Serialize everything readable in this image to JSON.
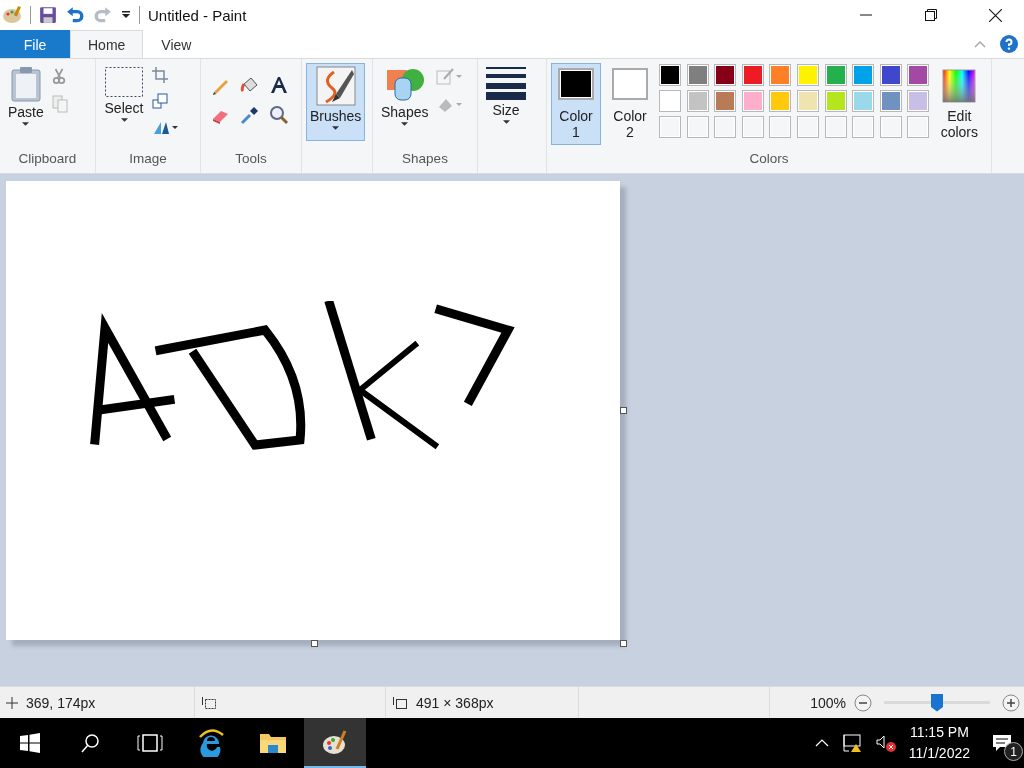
{
  "title_bar": {
    "title": "Untitled - Paint"
  },
  "tabs": [
    {
      "label": "File",
      "kind": "file",
      "selected": false
    },
    {
      "label": "Home",
      "kind": "tab",
      "selected": true
    },
    {
      "label": "View",
      "kind": "tab",
      "selected": false
    }
  ],
  "ribbon": {
    "groups": [
      {
        "kind": "clipboard",
        "label": "Clipboard",
        "button": {
          "label": "Paste",
          "selected": false
        }
      },
      {
        "kind": "image",
        "label": "Image",
        "button": {
          "label": "Select",
          "selected": false
        }
      },
      {
        "kind": "tools",
        "label": "Tools"
      },
      {
        "kind": "brushes",
        "button": {
          "label": "Brushes",
          "selected": true
        }
      },
      {
        "kind": "shapes",
        "label": "Shapes",
        "button": {
          "label": "Shapes",
          "selected": false
        }
      },
      {
        "kind": "size",
        "button": {
          "label": "Size",
          "selected": false
        }
      },
      {
        "kind": "colors",
        "label": "Colors",
        "current": [
          {
            "label": "Color 1",
            "color": "#000000",
            "selected": true
          },
          {
            "label": "Color 2",
            "color": "#ffffff",
            "selected": false
          }
        ],
        "palette": [
          {
            "color": "#000000"
          },
          {
            "color": "#7f7f7f"
          },
          {
            "color": "#880015"
          },
          {
            "color": "#ed1c24"
          },
          {
            "color": "#ff7f27"
          },
          {
            "color": "#fff200"
          },
          {
            "color": "#22b14c"
          },
          {
            "color": "#00a2e8"
          },
          {
            "color": "#3f48cc"
          },
          {
            "color": "#a349a4"
          },
          {
            "color": "#ffffff"
          },
          {
            "color": "#c3c3c3"
          },
          {
            "color": "#b97a57"
          },
          {
            "color": "#ffaec9"
          },
          {
            "color": "#ffc90e"
          },
          {
            "color": "#efe4b0"
          },
          {
            "color": "#b5e61d"
          },
          {
            "color": "#99d9ea"
          },
          {
            "color": "#7092be"
          },
          {
            "color": "#c8bfe7"
          }
        ],
        "edit_button": {
          "label": "Edit colors"
        }
      }
    ]
  },
  "status_bar": {
    "cursor_position": "369, 174px",
    "image_size": "491 × 368px",
    "zoom": "100%",
    "zoom_slider": {
      "level": 0.5
    }
  },
  "taskbar": {
    "apps": [
      {
        "kind": "browser",
        "selected": false
      },
      {
        "kind": "explorer",
        "selected": false
      },
      {
        "kind": "paint",
        "selected": true
      }
    ],
    "time": "11:15 PM",
    "date": "11/1/2022",
    "notification_count": "1"
  }
}
